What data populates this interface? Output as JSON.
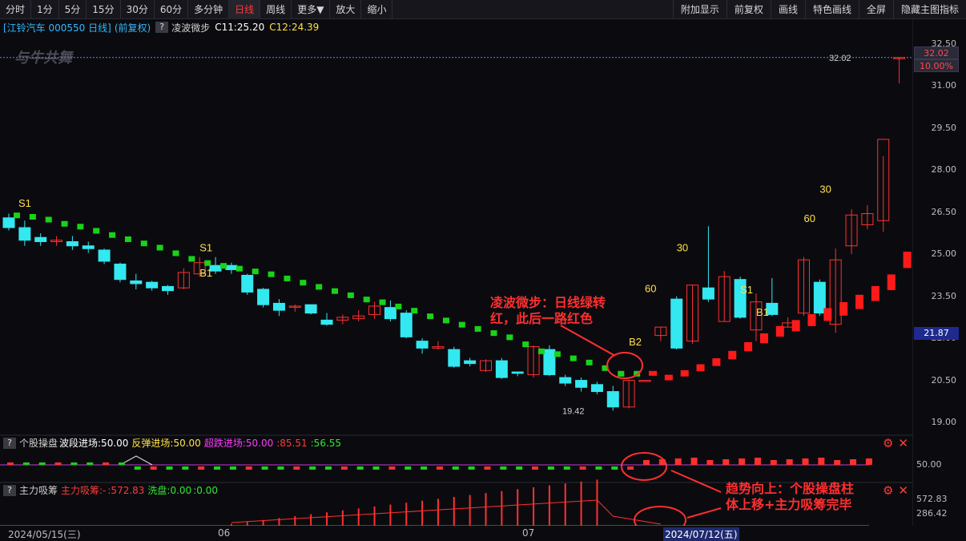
{
  "toolbar": {
    "left_buttons": [
      "分时",
      "1分",
      "5分",
      "15分",
      "30分",
      "60分",
      "多分钟",
      "日线",
      "周线",
      "更多▼",
      "放大",
      "缩小"
    ],
    "active": "日线",
    "right_buttons": [
      "附加显示",
      "前复权",
      "画线",
      "特色画线",
      "全屏",
      "隐藏主图指标"
    ]
  },
  "info": {
    "stock": "[江铃汽车 000550 日线]",
    "adjust": "(前复权)",
    "indicator_name": "凌波微步",
    "c1": "C11:25.20",
    "c2": "C12:24.39"
  },
  "watermark": "与牛共舞",
  "price_axis": {
    "ticks": [
      "32.50",
      "31.00",
      "29.50",
      "28.00",
      "26.50",
      "25.00",
      "23.50",
      "22.00",
      "20.50",
      "19.00"
    ],
    "last_price": "32.02",
    "last_pct": "10.00%",
    "cursor_price": "21.87",
    "high_label": "32.02",
    "low_label": "19.42"
  },
  "signals": [
    "S1",
    "S1",
    "B1",
    "B2",
    "60",
    "30",
    "60",
    "30",
    "S1",
    "B1"
  ],
  "panel1": {
    "help": "?",
    "name": "个股操盘",
    "f1": "波段进场:50.00",
    "f2": "反弹进场:50.00",
    "f3": "超跌进场:50.00",
    "f4": ":85.51",
    "f5": ":56.55",
    "axis_label": "50.00"
  },
  "panel2": {
    "help": "?",
    "name": "主力吸筹",
    "f1": "主力吸筹:-",
    "f2": ":572.83",
    "f3": "洗盘:0.00",
    "f4": ":0.00",
    "axis_hi": "572.83",
    "axis_lo": "286.42"
  },
  "dates": {
    "d1": "2024/05/15(三)",
    "d2": "06",
    "d3": "07",
    "d4": "2024/07/12(五)"
  },
  "annotations": {
    "a1_line1": "凌波微步：日线绿转",
    "a1_line2": "红，此后一路红色",
    "a2_line1": "趋势向上：个股操盘柱",
    "a2_line2": "体上移+主力吸筹完毕"
  },
  "colors": {
    "up": "#ff3030",
    "down": "#33e8f0",
    "green_dot": "#19d319",
    "red_dot": "#ff1a1a",
    "signal": "#ffe14a",
    "annotation": "#ff2f2f"
  },
  "chart_data": {
    "type": "candlestick",
    "candles": [
      [
        26.3,
        25.95,
        26.45,
        25.85
      ],
      [
        25.95,
        25.5,
        26.2,
        25.3
      ],
      [
        25.6,
        25.45,
        25.75,
        25.3
      ],
      [
        25.45,
        25.5,
        25.65,
        25.3
      ],
      [
        25.45,
        25.3,
        25.65,
        25.15
      ],
      [
        25.3,
        25.2,
        25.45,
        25.05
      ],
      [
        25.15,
        24.75,
        25.2,
        24.65
      ],
      [
        24.65,
        24.1,
        24.7,
        24.0
      ],
      [
        24.05,
        23.95,
        24.3,
        23.75
      ],
      [
        24.0,
        23.8,
        24.05,
        23.7
      ],
      [
        23.85,
        23.7,
        23.9,
        23.55
      ],
      [
        23.8,
        24.35,
        24.5,
        23.75
      ],
      [
        24.3,
        24.7,
        24.9,
        24.2
      ],
      [
        24.6,
        24.4,
        24.9,
        24.3
      ],
      [
        24.6,
        24.45,
        24.7,
        24.3
      ],
      [
        24.25,
        23.65,
        24.3,
        23.55
      ],
      [
        23.75,
        23.2,
        23.8,
        23.1
      ],
      [
        23.25,
        23.0,
        23.4,
        22.8
      ],
      [
        23.15,
        23.15,
        23.2,
        22.95
      ],
      [
        23.2,
        22.9,
        23.2,
        22.85
      ],
      [
        22.65,
        22.5,
        22.9,
        22.45
      ],
      [
        22.65,
        22.75,
        22.85,
        22.5
      ],
      [
        22.7,
        22.8,
        23.0,
        22.6
      ],
      [
        22.85,
        23.15,
        23.3,
        22.7
      ],
      [
        23.1,
        22.7,
        23.35,
        22.6
      ],
      [
        22.9,
        22.05,
        23.0,
        22.0
      ],
      [
        21.9,
        21.65,
        22.0,
        21.45
      ],
      [
        21.65,
        21.7,
        21.9,
        21.6
      ],
      [
        21.6,
        21.0,
        21.7,
        20.95
      ],
      [
        21.2,
        21.1,
        21.3,
        21.0
      ],
      [
        20.85,
        21.2,
        21.25,
        20.8
      ],
      [
        21.2,
        20.6,
        21.3,
        20.55
      ],
      [
        20.8,
        20.75,
        20.8,
        20.65
      ],
      [
        20.7,
        21.7,
        21.75,
        20.6
      ],
      [
        21.6,
        20.7,
        21.75,
        20.65
      ],
      [
        20.6,
        20.4,
        20.7,
        20.3
      ],
      [
        20.5,
        20.25,
        20.6,
        20.1
      ],
      [
        20.35,
        20.1,
        20.45,
        20.0
      ],
      [
        20.1,
        19.55,
        20.3,
        19.42
      ],
      [
        19.55,
        20.5,
        20.5,
        19.5
      ],
      [
        20.5,
        20.5,
        20.5,
        20.5
      ],
      [
        22.1,
        22.4,
        22.4,
        21.9
      ],
      [
        23.4,
        21.65,
        23.5,
        21.6
      ],
      [
        21.9,
        23.9,
        23.9,
        21.8
      ],
      [
        23.8,
        23.4,
        26.0,
        23.3
      ],
      [
        22.6,
        24.2,
        24.4,
        22.6
      ],
      [
        24.1,
        22.75,
        24.2,
        22.7
      ],
      [
        22.3,
        23.3,
        23.6,
        21.9
      ],
      [
        23.25,
        22.85,
        24.15,
        22.8
      ],
      [
        22.4,
        22.55,
        22.75,
        22.4
      ],
      [
        22.9,
        24.8,
        24.9,
        22.8
      ],
      [
        24.0,
        22.9,
        24.1,
        22.8
      ],
      [
        22.5,
        24.8,
        25.2,
        22.2
      ],
      [
        25.3,
        26.4,
        26.6,
        25.0
      ],
      [
        26.05,
        26.45,
        26.75,
        25.9
      ],
      [
        26.2,
        29.1,
        28.5,
        25.8
      ],
      [
        32.02,
        32.02,
        32.02,
        31.1
      ]
    ],
    "trend_dots": [
      26.4,
      26.35,
      26.25,
      26.1,
      26.0,
      25.85,
      25.7,
      25.55,
      25.4,
      25.25,
      25.05,
      24.85,
      24.7,
      24.6,
      24.5,
      24.4,
      24.3,
      24.15,
      24.0,
      23.85,
      23.7,
      23.55,
      23.4,
      23.3,
      23.15,
      23.0,
      22.8,
      22.65,
      22.5,
      22.35,
      22.2,
      22.05,
      21.8,
      21.55,
      21.45,
      21.3,
      21.15,
      20.95,
      20.75,
      20.75,
      20.75,
      20.6,
      20.75,
      20.95,
      21.15,
      21.4,
      21.7,
      22.0,
      22.25,
      22.45,
      22.65,
      22.85,
      23.05,
      23.3,
      23.6,
      24.0,
      24.8
    ],
    "trend_red_from_index": 40
  }
}
